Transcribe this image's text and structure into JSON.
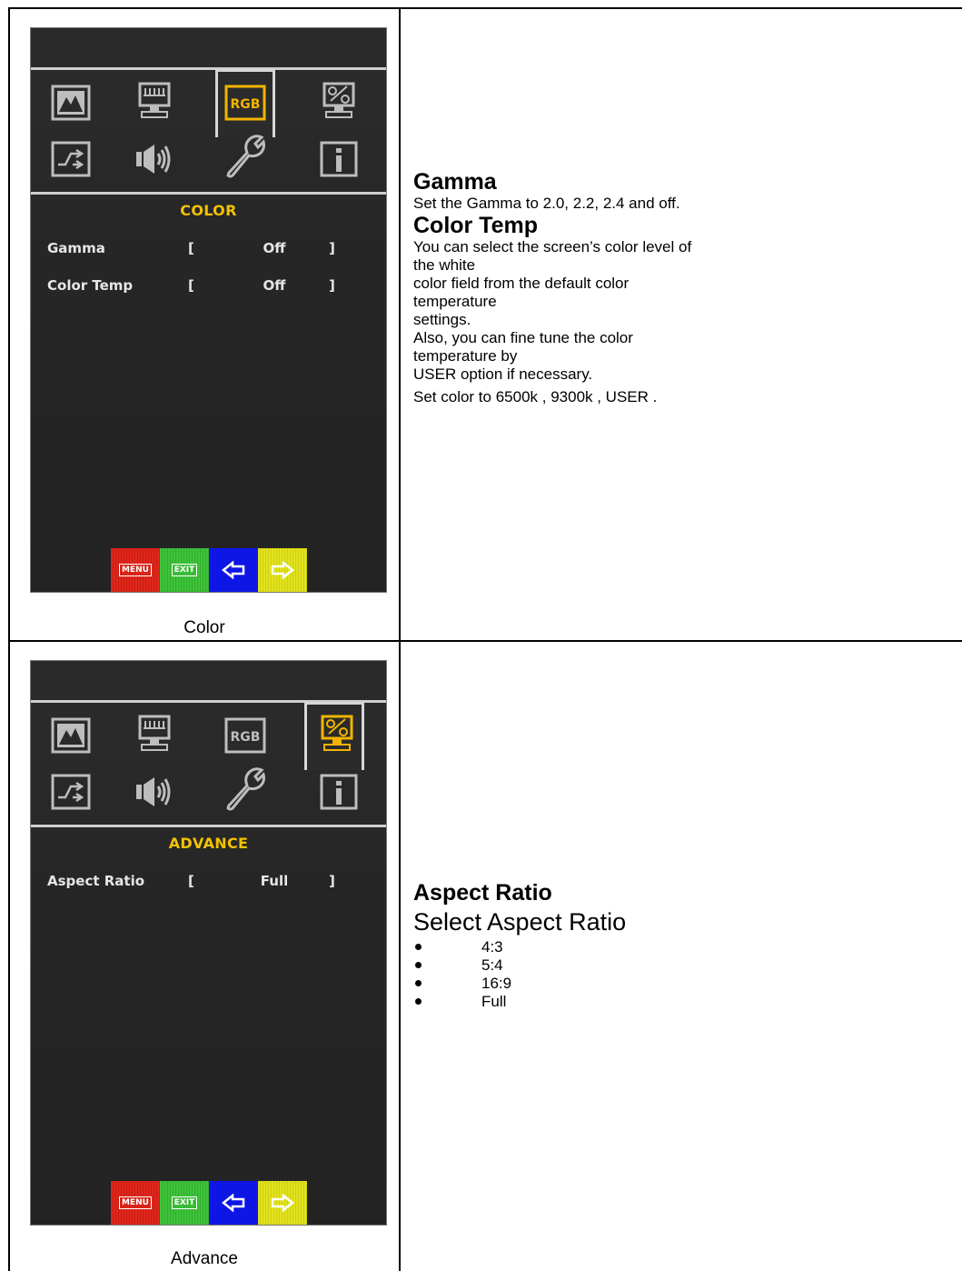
{
  "row1": {
    "caption": "Color",
    "osd": {
      "title": "COLOR",
      "items": [
        {
          "label": "Gamma",
          "left_bracket": "[",
          "value": "Off",
          "right_bracket": "]"
        },
        {
          "label": "Color Temp",
          "left_bracket": "[",
          "value": "Off",
          "right_bracket": "]"
        }
      ],
      "selected_icon": "rgb-icon",
      "rgb_icon_text": "RGB",
      "keys": {
        "menu": "MENU",
        "exit": "EXIT"
      }
    },
    "text": {
      "heading1": "Gamma",
      "para1": "Set the Gamma to 2.0, 2.2, 2.4 and off.",
      "heading2": "Color Temp",
      "lines": [
        "You can select the screen’s color level of",
        "the white",
        "color field from the default color",
        "temperature",
        "settings.",
        "Also, you can fine tune the color",
        "temperature by",
        "USER option if necessary."
      ],
      "para3": "Set color to 6500k , 9300k , USER ."
    }
  },
  "row2": {
    "caption": "Advance",
    "osd": {
      "title": "ADVANCE",
      "items": [
        {
          "label": "Aspect Ratio",
          "left_bracket": "[",
          "value": "Full",
          "right_bracket": "]"
        }
      ],
      "selected_icon": "advance-icon",
      "rgb_icon_text": "RGB",
      "keys": {
        "menu": "MENU",
        "exit": "EXIT"
      }
    },
    "text": {
      "heading": "Aspect Ratio",
      "subheading": "Select Aspect Ratio",
      "options": [
        "4:3",
        "5:4",
        "16:9",
        "Full"
      ]
    }
  },
  "colors": {
    "osd_title": "#f2c200",
    "selected_icon": "#f2b400",
    "icon_gray": "#b9b9b9"
  }
}
